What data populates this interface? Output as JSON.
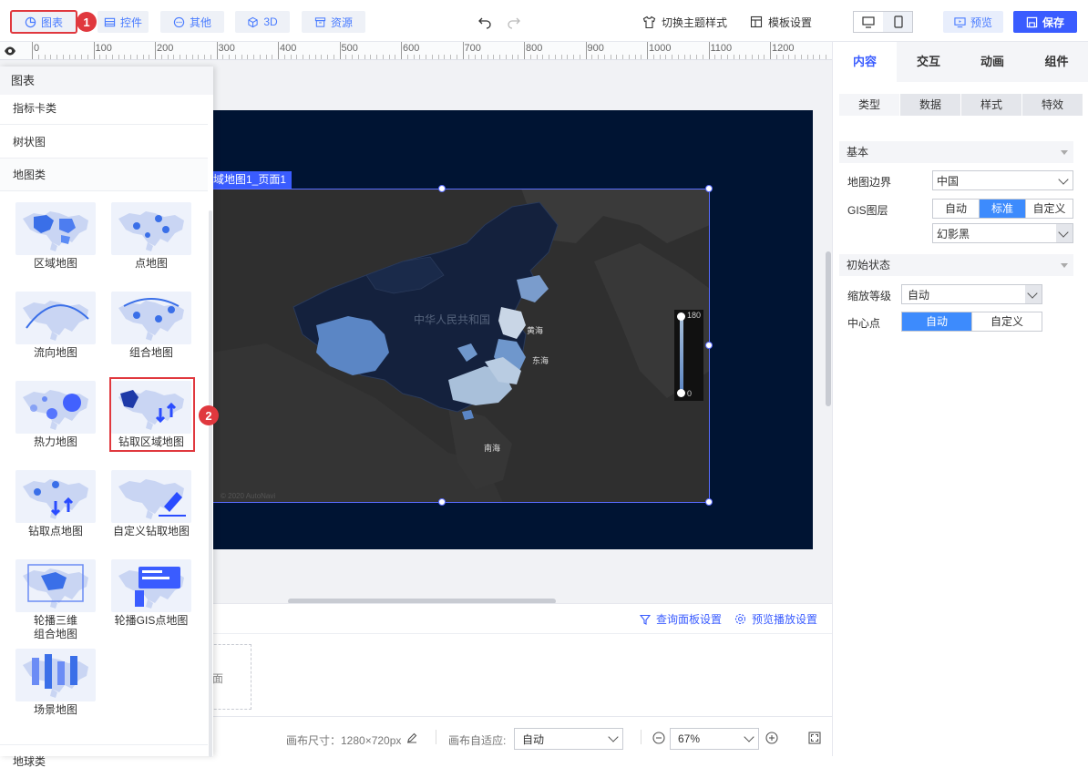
{
  "toolbar": {
    "chart_btn": "图表",
    "controls_btn": "控件",
    "other_btn": "其他",
    "threed_btn": "3D",
    "resource_btn": "资源",
    "theme_btn": "切换主题样式",
    "template_btn": "模板设置",
    "preview_btn": "预览",
    "save_btn": "保存",
    "badge1": "1",
    "badge2": "2"
  },
  "ruler": {
    "labels": [
      "0",
      "100",
      "200",
      "300",
      "400",
      "500",
      "600",
      "700",
      "800",
      "900",
      "1000",
      "1100",
      "1200"
    ]
  },
  "left_panel": {
    "title": "图表",
    "categories": [
      "指标卡类",
      "树状图",
      "地图类"
    ],
    "items": [
      {
        "label": "区域地图"
      },
      {
        "label": "点地图"
      },
      {
        "label": "流向地图"
      },
      {
        "label": "组合地图"
      },
      {
        "label": "热力地图"
      },
      {
        "label": "钻取区域地图"
      },
      {
        "label": "钻取点地图"
      },
      {
        "label": "自定义钻取地图"
      },
      {
        "label": "轮播三维\n组合地图"
      },
      {
        "label": "轮播GIS点地图"
      },
      {
        "label": "场景地图"
      }
    ],
    "next_category": "地球类"
  },
  "canvas": {
    "widget_tag": "域地图1_页面1",
    "map_labels": {
      "yellow_sea": "黄海",
      "east_sea": "东海",
      "south_sea": "南海",
      "country": "中华人民共和国",
      "copyright": "© 2020 AutoNavi"
    },
    "legend_max": "180",
    "legend_min": "0",
    "colors": {
      "stage": "#001433",
      "region_dark": "#14213d",
      "region_mid": "#5b86c5",
      "region_light": "#a9c0da"
    }
  },
  "bottom": {
    "query_panel": "查询面板设置",
    "preview_play": "预览播放设置",
    "placeholder_text": "面",
    "canvas_size_label": "画布尺寸：1280×720px",
    "canvas_fit_label": "画布自适应:",
    "canvas_fit_value": "自动",
    "zoom_value": "67%"
  },
  "right_panel": {
    "tabs": [
      "内容",
      "交互",
      "动画",
      "组件"
    ],
    "subtabs": [
      "类型",
      "数据",
      "样式",
      "特效"
    ],
    "section_basic": "基本",
    "map_border_label": "地图边界",
    "map_border_value": "中国",
    "gis_label": "GIS图层",
    "gis_options": [
      "自动",
      "标准",
      "自定义"
    ],
    "gis_style_value": "幻影黑",
    "section_init": "初始状态",
    "zoom_label": "缩放等级",
    "zoom_value": "自动",
    "center_label": "中心点",
    "center_options": [
      "自动",
      "自定义"
    ]
  }
}
